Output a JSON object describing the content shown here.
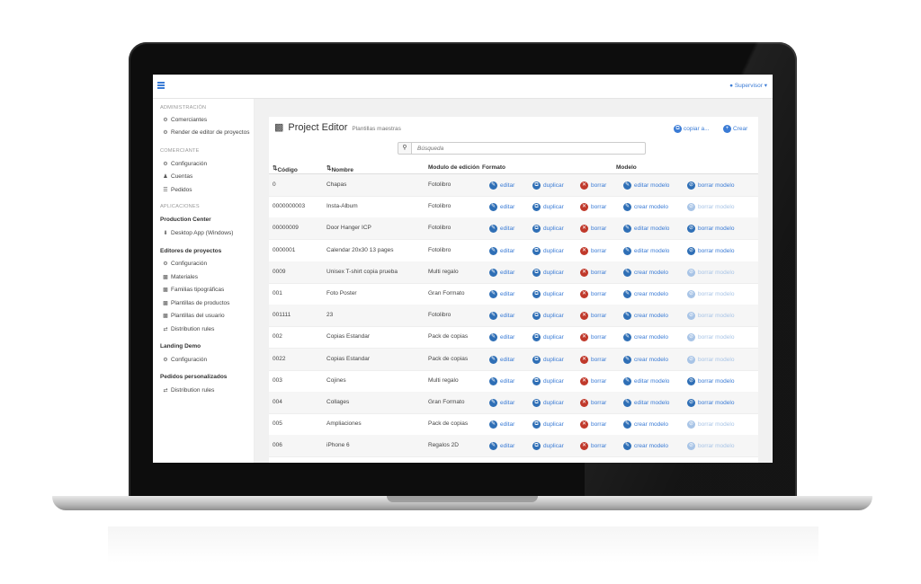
{
  "topbar": {
    "user": "Supervisor"
  },
  "sidebar": {
    "sections": [
      {
        "title": "ADMINISTRACIÓN",
        "items": [
          {
            "icon": "gear-icon",
            "label": "Comerciantes"
          },
          {
            "icon": "gear-icon",
            "label": "Render de editor de proyectos"
          }
        ]
      },
      {
        "title": "COMERCIANTE",
        "items": [
          {
            "icon": "gear-icon",
            "label": "Configuración"
          },
          {
            "icon": "users-icon",
            "label": "Cuentas"
          },
          {
            "icon": "list-icon",
            "label": "Pedidos"
          }
        ]
      },
      {
        "title": "APLICACIONES",
        "groups": [
          {
            "title": "Production Center",
            "items": [
              {
                "icon": "download-icon",
                "label": "Desktop App (Windows)"
              }
            ]
          },
          {
            "title": "Editores de proyectos",
            "items": [
              {
                "icon": "gear-icon",
                "label": "Configuración"
              },
              {
                "icon": "cubes-icon",
                "label": "Materiales"
              },
              {
                "icon": "cubes-icon",
                "label": "Familias tipográficas"
              },
              {
                "icon": "cubes-icon",
                "label": "Plantillas de productos"
              },
              {
                "icon": "cubes-icon",
                "label": "Plantillas del usuario"
              },
              {
                "icon": "shuffle-icon",
                "label": "Distribution rules"
              }
            ]
          },
          {
            "title": "Landing Demo",
            "items": [
              {
                "icon": "gear-icon",
                "label": "Configuración"
              }
            ]
          },
          {
            "title": "Pedidos personalizados",
            "items": [
              {
                "icon": "shuffle-icon",
                "label": "Distribution rules"
              }
            ]
          }
        ]
      }
    ]
  },
  "panel": {
    "title": "Project Editor",
    "subtitle": "Plantillas maestras",
    "copy_label": "copiar a...",
    "create_label": "Crear",
    "search_placeholder": "Búsqueda"
  },
  "table": {
    "headers": {
      "code": "Código",
      "name": "Nombre",
      "module": "Modulo de edición",
      "format": "Formato",
      "model": "Modelo"
    },
    "action_labels": {
      "edit": "editar",
      "duplicate": "duplicar",
      "delete": "borrar",
      "edit_model": "editar modelo",
      "create_model": "crear modelo",
      "delete_model": "borrar modelo"
    },
    "rows": [
      {
        "code": "0",
        "name": "Chapas",
        "module": "Fotolibro",
        "has_model": true
      },
      {
        "code": "0000000003",
        "name": "Insta-Album",
        "module": "Fotolibro",
        "has_model": false
      },
      {
        "code": "00000009",
        "name": "Door Hanger ICP",
        "module": "Fotolibro",
        "has_model": true
      },
      {
        "code": "0000001",
        "name": "Calendar 20x30 13 pages",
        "module": "Fotolibro",
        "has_model": true
      },
      {
        "code": "0009",
        "name": "Unisex T-shirt copia prueba",
        "module": "Multi regalo",
        "has_model": false
      },
      {
        "code": "001",
        "name": "Foto Poster",
        "module": "Gran Formato",
        "has_model": false
      },
      {
        "code": "001111",
        "name": "23",
        "module": "Fotolibro",
        "has_model": false
      },
      {
        "code": "002",
        "name": "Copias Estandar",
        "module": "Pack de copias",
        "has_model": false
      },
      {
        "code": "0022",
        "name": "Copias Estandar",
        "module": "Pack de copias",
        "has_model": false
      },
      {
        "code": "003",
        "name": "Cojines",
        "module": "Multi regalo",
        "has_model": true
      },
      {
        "code": "004",
        "name": "Collages",
        "module": "Gran Formato",
        "has_model": true
      },
      {
        "code": "005",
        "name": "Ampliaciones",
        "module": "Pack de copias",
        "has_model": false
      },
      {
        "code": "006",
        "name": "iPhone 6",
        "module": "Regalos 2D",
        "has_model": false
      }
    ]
  },
  "colors": {
    "accent": "#3a7bd5",
    "danger": "#c0392b",
    "disabled": "#a8c4e6"
  }
}
